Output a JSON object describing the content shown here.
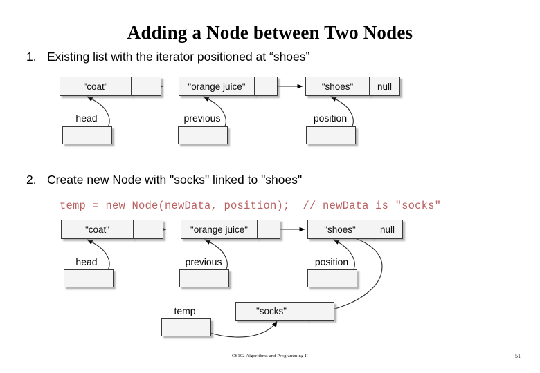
{
  "slide": {
    "title": "Adding a Node between Two Nodes",
    "footer_text": "CS102 Algorithms and Programming II",
    "page_number": "51",
    "code_color": "#bb6060"
  },
  "steps": [
    {
      "number": "1.",
      "text": "Existing list with the iterator positioned at “shoes”"
    },
    {
      "number": "2.",
      "text": "Create new Node with \"socks\" linked to \"shoes\""
    }
  ],
  "code": "temp = new Node(newData, position);  // newData is \"socks\"",
  "diagram1": {
    "nodes": [
      {
        "data": "\"coat\"",
        "link": ""
      },
      {
        "data": "\"orange juice\"",
        "link": ""
      },
      {
        "data": "\"shoes\"",
        "link": "null"
      }
    ],
    "variables": [
      {
        "label": "head",
        "value": ""
      },
      {
        "label": "previous",
        "value": ""
      },
      {
        "label": "position",
        "value": ""
      }
    ]
  },
  "diagram2": {
    "nodes": [
      {
        "data": "\"coat\"",
        "link": ""
      },
      {
        "data": "\"orange juice\"",
        "link": ""
      },
      {
        "data": "\"shoes\"",
        "link": "null"
      }
    ],
    "variables": [
      {
        "label": "head",
        "value": ""
      },
      {
        "label": "previous",
        "value": ""
      },
      {
        "label": "position",
        "value": ""
      }
    ],
    "new_node": {
      "data": "\"socks\"",
      "link": ""
    },
    "new_variable": {
      "label": "temp",
      "value": ""
    }
  }
}
